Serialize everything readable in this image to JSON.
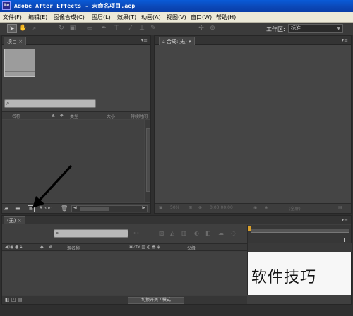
{
  "window": {
    "title": "Adobe After Effects - 未命名项目.aep",
    "icon_text": "Ae"
  },
  "menu": [
    "文件(F)",
    "编辑(E)",
    "图像合成(C)",
    "图层(L)",
    "效果(T)",
    "动画(A)",
    "视图(V)",
    "窗口(W)",
    "帮助(H)"
  ],
  "toolbar": {
    "workspace_label": "工作区:",
    "workspace_value": "标准",
    "tools": [
      "selection-tool",
      "hand-tool",
      "zoom-tool",
      "rotate-tool",
      "camera-tool",
      "pan-behind-tool",
      "mask-tool",
      "pen-tool",
      "text-tool",
      "brush-tool",
      "clone-tool",
      "eraser-tool",
      "roto-tool",
      "puppet-tool"
    ]
  },
  "project_panel": {
    "tab": "项目",
    "search_placeholder": "",
    "columns": [
      "名称",
      "类型",
      "大小",
      "持续时间"
    ],
    "footer_bpc": "8 bpc"
  },
  "comp_panel": {
    "tab": "合成:(无)",
    "zoom": "50%",
    "resolution": "(全屏)"
  },
  "timeline_panel": {
    "tab": "(无)",
    "time_code": "0:00:00:00",
    "layer_columns": [
      "源名称",
      "父级"
    ],
    "toggle_switches_label": "切换开关 / 模式"
  },
  "watermark": "软件技巧",
  "colors": {
    "title_bar": "#0b48b8",
    "panel_bg": "#454545",
    "marker": "#d9a02c"
  }
}
